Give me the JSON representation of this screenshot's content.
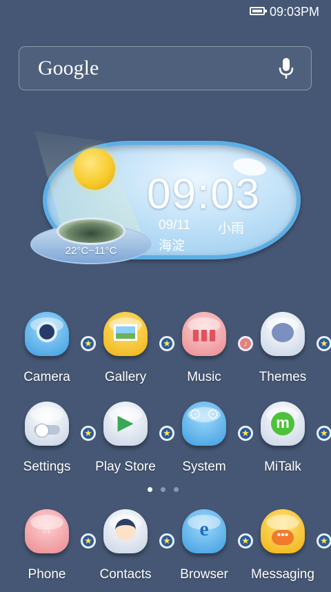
{
  "status_bar": {
    "time": "09:03PM",
    "battery_icon": "battery-icon"
  },
  "search": {
    "logo_text": "Google",
    "mic_icon": "microphone-icon"
  },
  "weather": {
    "time": "09:03",
    "date": "09/11",
    "condition": "小雨",
    "city": "海淀",
    "temperature": "22°C~11°C"
  },
  "apps": [
    {
      "label": "Camera",
      "icon": "camera-icon",
      "color": "#5bb6ef"
    },
    {
      "label": "Gallery",
      "icon": "gallery-icon",
      "color": "#f6c31f"
    },
    {
      "label": "Music",
      "icon": "music-icon",
      "color": "#f4a3a7"
    },
    {
      "label": "Themes",
      "icon": "themes-icon",
      "color": "#e3e9f4"
    },
    {
      "label": "Settings",
      "icon": "settings-icon",
      "color": "#e3e9f4"
    },
    {
      "label": "Play Store",
      "icon": "play-store-icon",
      "color": "#e3e9f4"
    },
    {
      "label": "System",
      "icon": "system-icon",
      "color": "#5bb6ef"
    },
    {
      "label": "MiTalk",
      "icon": "mitalk-icon",
      "color": "#e3e9f4"
    },
    {
      "label": "Phone",
      "icon": "phone-icon",
      "color": "#f4a3a7"
    },
    {
      "label": "Contacts",
      "icon": "contacts-icon",
      "color": "#e3e9f4"
    },
    {
      "label": "Browser",
      "icon": "browser-icon",
      "color": "#5bb6ef"
    },
    {
      "label": "Messaging",
      "icon": "messaging-icon",
      "color": "#f6c31f"
    }
  ],
  "page_indicator": {
    "pages": 3,
    "current": 1
  }
}
